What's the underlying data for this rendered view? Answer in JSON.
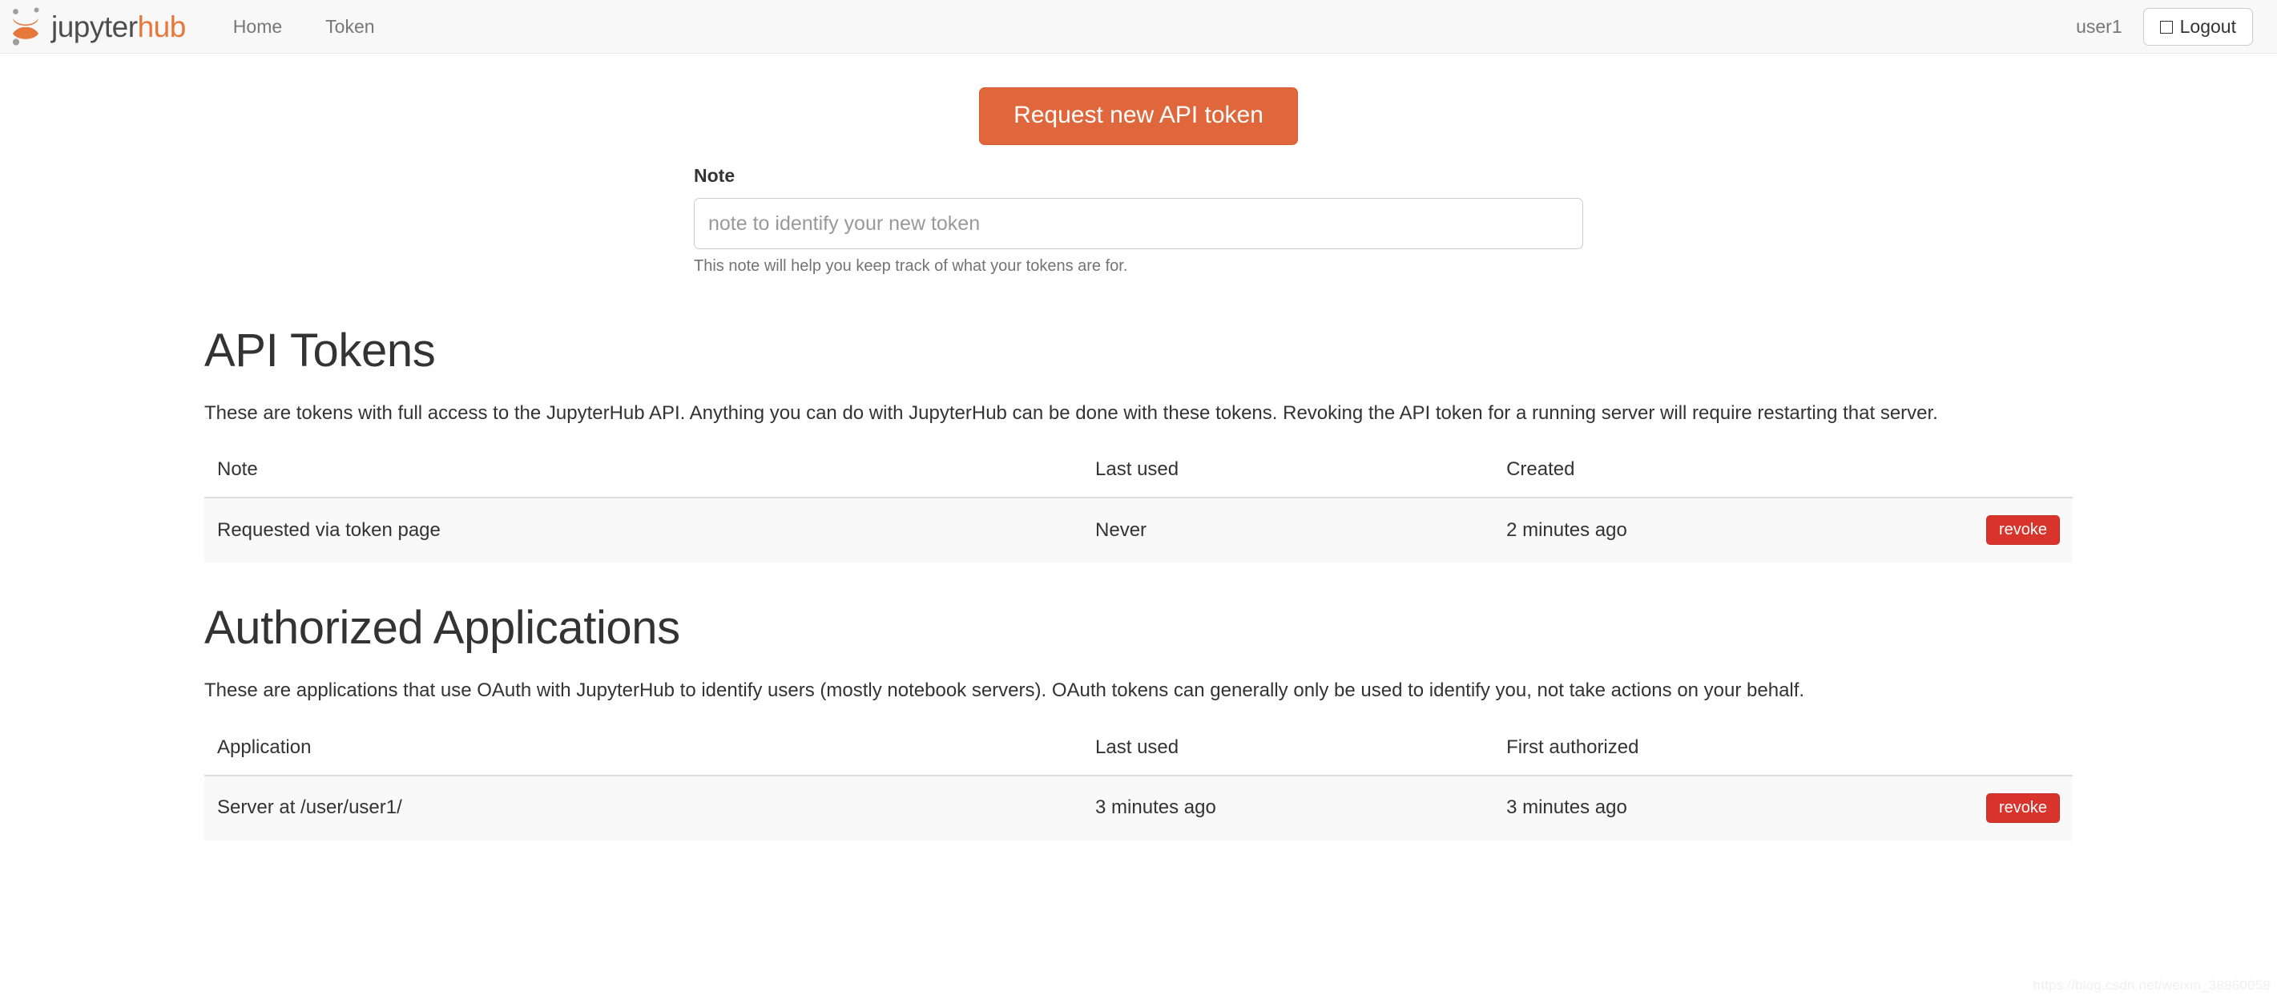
{
  "navbar": {
    "brand": {
      "logo_icon": "jupyter-logo-icon",
      "text_primary": "jupyter",
      "text_accent": "hub"
    },
    "links": [
      {
        "label": "Home",
        "name": "nav-link-home"
      },
      {
        "label": "Token",
        "name": "nav-link-token"
      }
    ],
    "user": "user1",
    "logout": {
      "icon": "sign-out-icon",
      "label": "Logout"
    }
  },
  "token_form": {
    "request_button": "Request new API token",
    "note_label": "Note",
    "note_value": "",
    "note_placeholder": "note to identify your new token",
    "note_help": "This note will help you keep track of what your tokens are for."
  },
  "api_tokens": {
    "heading": "API Tokens",
    "description": "These are tokens with full access to the JupyterHub API. Anything you can do with JupyterHub can be done with these tokens. Revoking the API token for a running server will require restarting that server.",
    "columns": [
      "Note",
      "Last used",
      "Created",
      ""
    ],
    "rows": [
      {
        "note": "Requested via token page",
        "last_used": "Never",
        "created": "2 minutes ago",
        "action": "revoke"
      }
    ]
  },
  "authorized_applications": {
    "heading": "Authorized Applications",
    "description": "These are applications that use OAuth with JupyterHub to identify users (mostly notebook servers). OAuth tokens can generally only be used to identify you, not take actions on your behalf.",
    "columns": [
      "Application",
      "Last used",
      "First authorized",
      ""
    ],
    "rows": [
      {
        "application": "Server at /user/user1/",
        "last_used": "3 minutes ago",
        "first_authorized": "3 minutes ago",
        "action": "revoke"
      }
    ]
  },
  "watermark": "https://blog.csdn.net/weixin_38860058",
  "colors": {
    "brand_accent": "#e8773a",
    "primary_button": "#e0673c",
    "danger_button": "#d9342b",
    "navbar_bg": "#f8f8f8",
    "row_bg": "#f9f9f9"
  }
}
